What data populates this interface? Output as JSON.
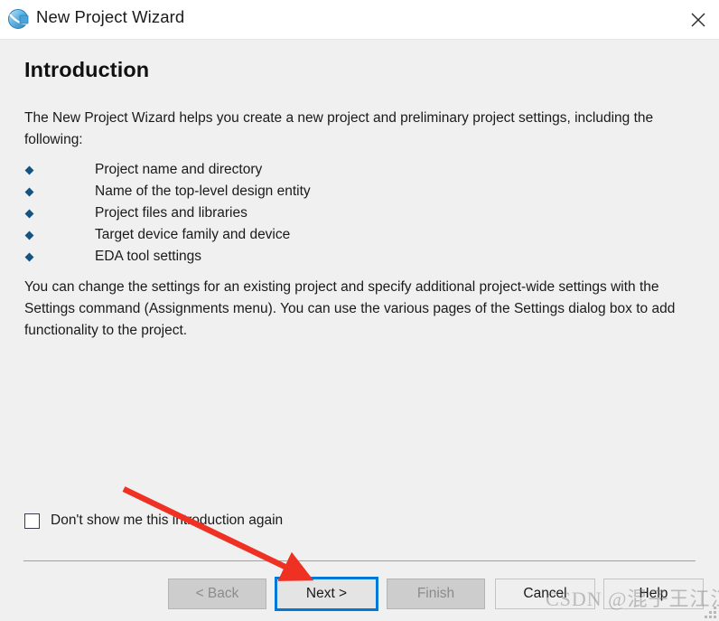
{
  "window": {
    "title": "New Project Wizard",
    "icon": "quartus-sphere-icon",
    "close_icon": "close-icon"
  },
  "page": {
    "heading": "Introduction",
    "intro_paragraph": "The New Project Wizard helps you create a new project and preliminary project settings, including the following:",
    "bullets": [
      "Project name and directory",
      "Name of the top-level design entity",
      "Project files and libraries",
      "Target device family and device",
      "EDA tool settings"
    ],
    "settings_paragraph": "You can change the settings for an existing project and specify additional project-wide settings with the Settings command (Assignments menu). You can use the various pages of the Settings dialog box to add functionality to the project."
  },
  "options": {
    "dont_show_label": "Don't show me this introduction again",
    "dont_show_checked": false
  },
  "buttons": {
    "back": {
      "label": "< Back",
      "enabled": false
    },
    "next": {
      "label": "Next >",
      "enabled": true,
      "focused": true
    },
    "finish": {
      "label": "Finish",
      "enabled": false
    },
    "cancel": {
      "label": "Cancel",
      "enabled": true
    },
    "help": {
      "label": "Help",
      "enabled": true
    }
  },
  "annotation": {
    "arrow_color": "#ef3124",
    "points_to": "next-button"
  },
  "watermark": {
    "text": "CSDN @混子王江江"
  },
  "colors": {
    "titlebar_bg": "#ffffff",
    "content_bg": "#f0f0f0",
    "bullet": "#17537f",
    "focus_border": "#0078d7",
    "button_bg": "#cdcdcd",
    "disabled_text": "#8b8b8b"
  }
}
